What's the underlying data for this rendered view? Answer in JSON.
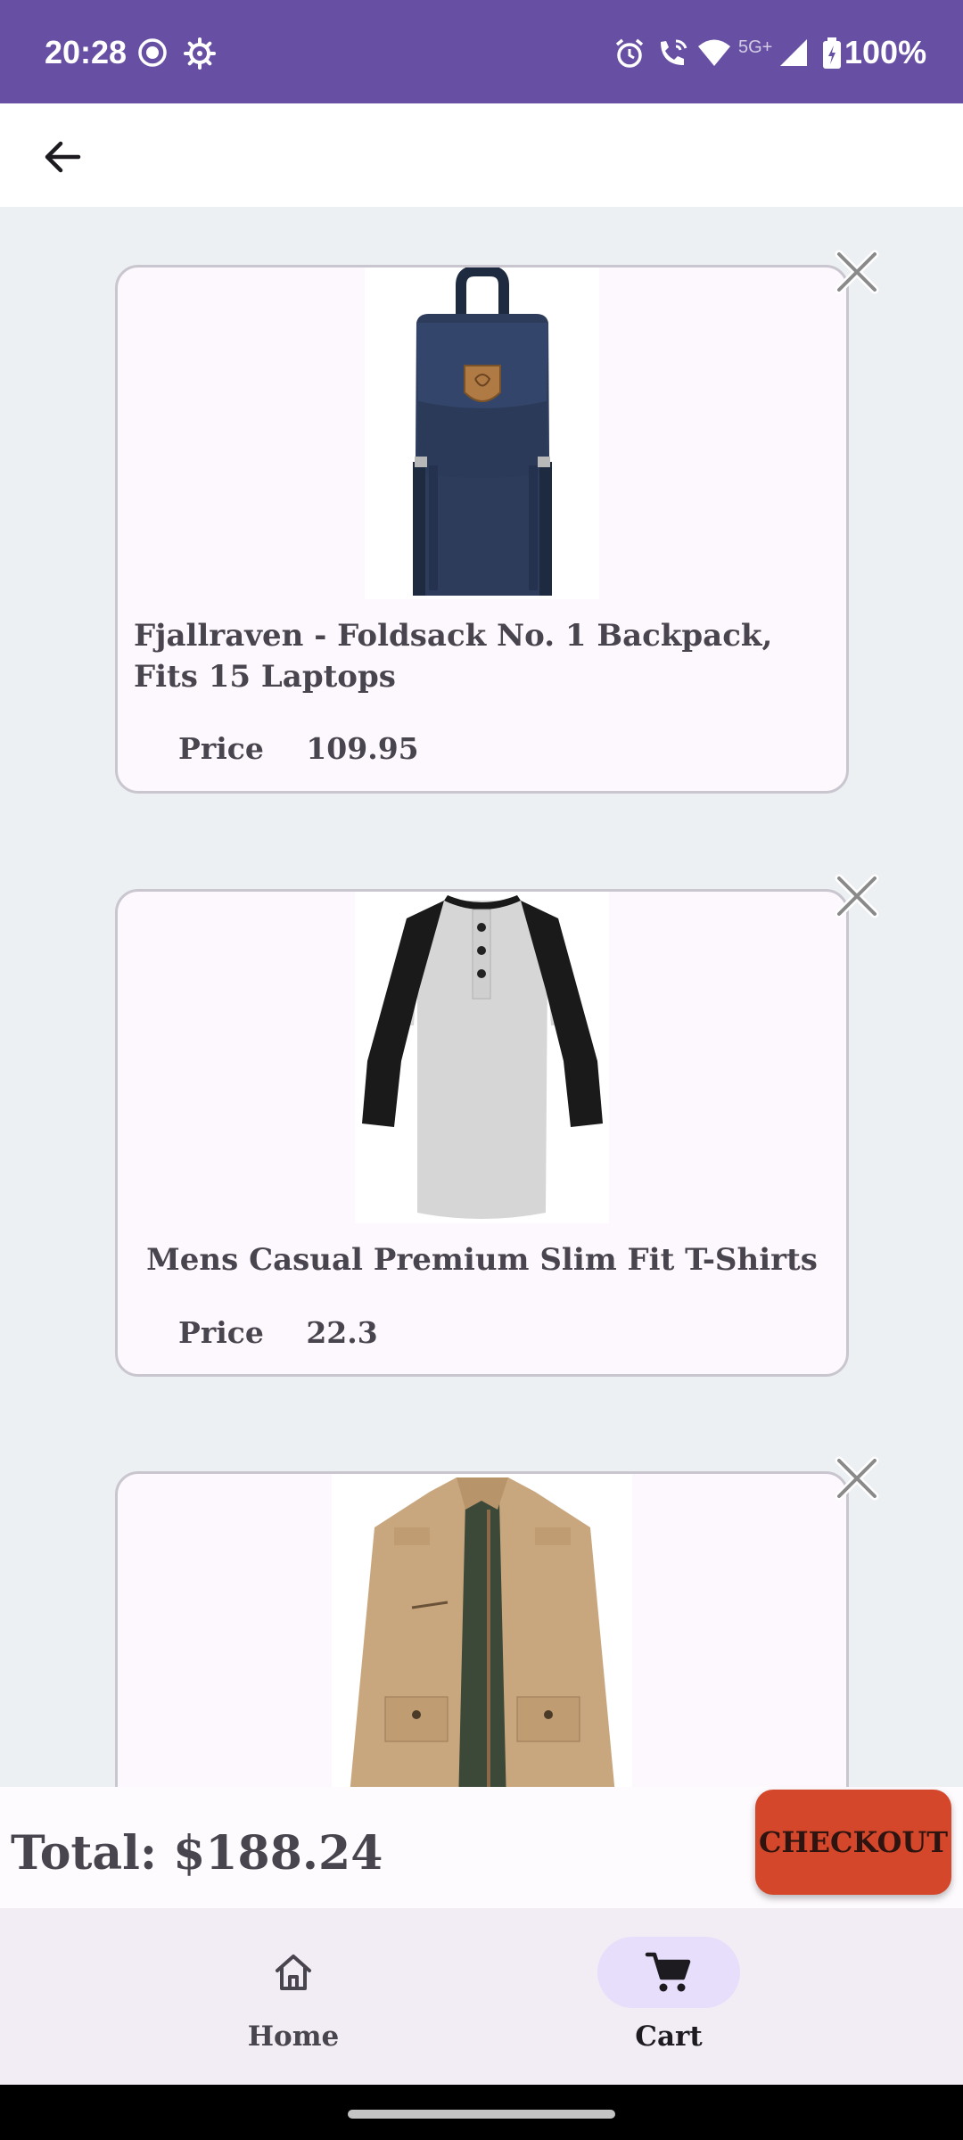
{
  "status_bar": {
    "time": "20:28",
    "network": "5G+",
    "battery": "100%",
    "icons": [
      "record-icon",
      "settings-gear-icon",
      "alarm-icon",
      "wifi-calling-icon",
      "wifi-icon",
      "signal-icon",
      "battery-icon"
    ]
  },
  "app_bar": {
    "back_icon": "arrow-back-icon"
  },
  "cart_items": [
    {
      "title": "Fjallraven - Foldsack No. 1 Backpack, Fits 15 Laptops",
      "price_label": "Price",
      "price": "109.95",
      "image": "navy-backpack",
      "remove_icon": "close-icon"
    },
    {
      "title": "Mens Casual Premium Slim Fit T-Shirts",
      "price_label": "Price",
      "price": "22.3",
      "image": "raglan-henley-tshirt",
      "remove_icon": "close-icon"
    },
    {
      "title": "",
      "price_label": "",
      "price": "",
      "image": "khaki-jacket",
      "remove_icon": "close-icon"
    }
  ],
  "footer": {
    "total": "Total: $188.24",
    "checkout_label": "CHECKOUT"
  },
  "bottom_nav": {
    "items": [
      {
        "label": "Home",
        "icon": "home-icon",
        "active": false
      },
      {
        "label": "Cart",
        "icon": "shopping-cart-icon",
        "active": true
      }
    ]
  },
  "colors": {
    "status_bar": "#6750a4",
    "checkout": "#d5472a",
    "card_bg": "#fdf7fe",
    "nav_active": "#e7defb"
  }
}
